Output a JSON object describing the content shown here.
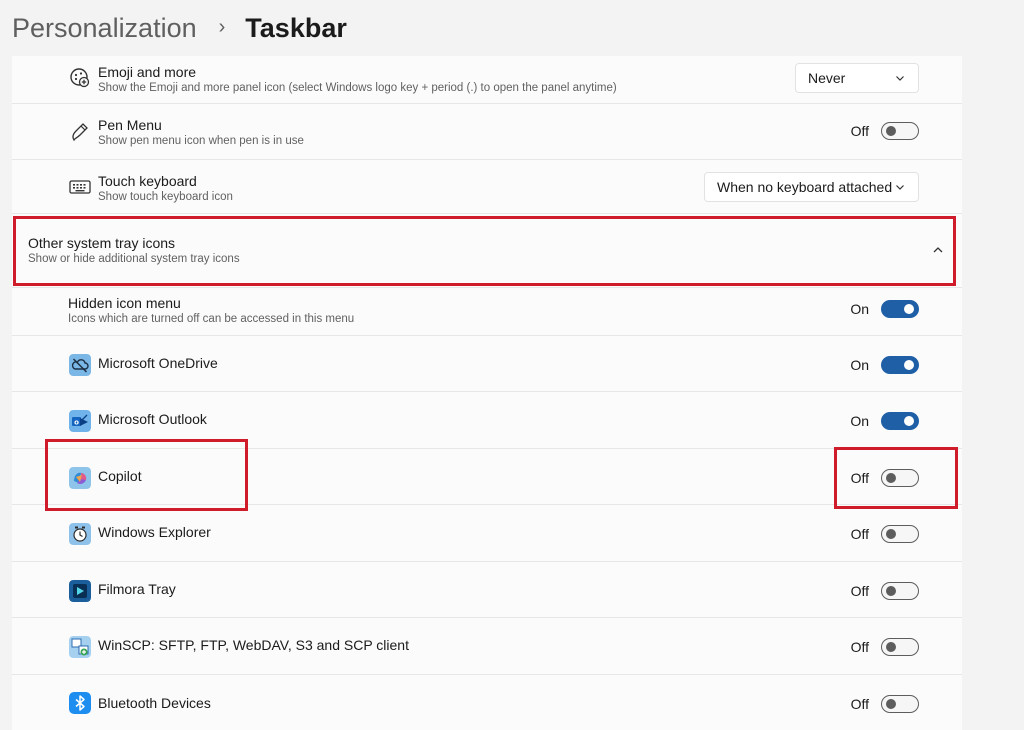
{
  "breadcrumb": {
    "parent": "Personalization",
    "separator": "›",
    "current": "Taskbar"
  },
  "rows": {
    "emoji": {
      "title": "Emoji and more",
      "desc": "Show the Emoji and more panel icon (select Windows logo key + period (.) to open the panel anytime)",
      "value": "Never"
    },
    "pen": {
      "title": "Pen Menu",
      "desc": "Show pen menu icon when pen is in use",
      "state": "Off"
    },
    "touch": {
      "title": "Touch keyboard",
      "desc": "Show touch keyboard icon",
      "value": "When no keyboard attached"
    },
    "other": {
      "title": "Other system tray icons",
      "desc": "Show or hide additional system tray icons"
    },
    "hidden": {
      "title": "Hidden icon menu",
      "desc": "Icons which are turned off can be accessed in this menu",
      "state": "On"
    },
    "onedrive": {
      "title": "Microsoft OneDrive",
      "state": "On"
    },
    "outlook": {
      "title": "Microsoft Outlook",
      "state": "On"
    },
    "copilot": {
      "title": "Copilot",
      "state": "Off"
    },
    "explorer": {
      "title": "Windows Explorer",
      "state": "Off"
    },
    "filmora": {
      "title": "Filmora Tray",
      "state": "Off"
    },
    "winscp": {
      "title": "WinSCP: SFTP, FTP, WebDAV, S3 and SCP client",
      "state": "Off"
    },
    "bluetooth": {
      "title": "Bluetooth Devices",
      "state": "Off"
    }
  },
  "colors": {
    "accent": "#1f5fa6",
    "highlight": "#d01c2a",
    "background": "#f3f3f3",
    "card": "#fbfbfb"
  }
}
